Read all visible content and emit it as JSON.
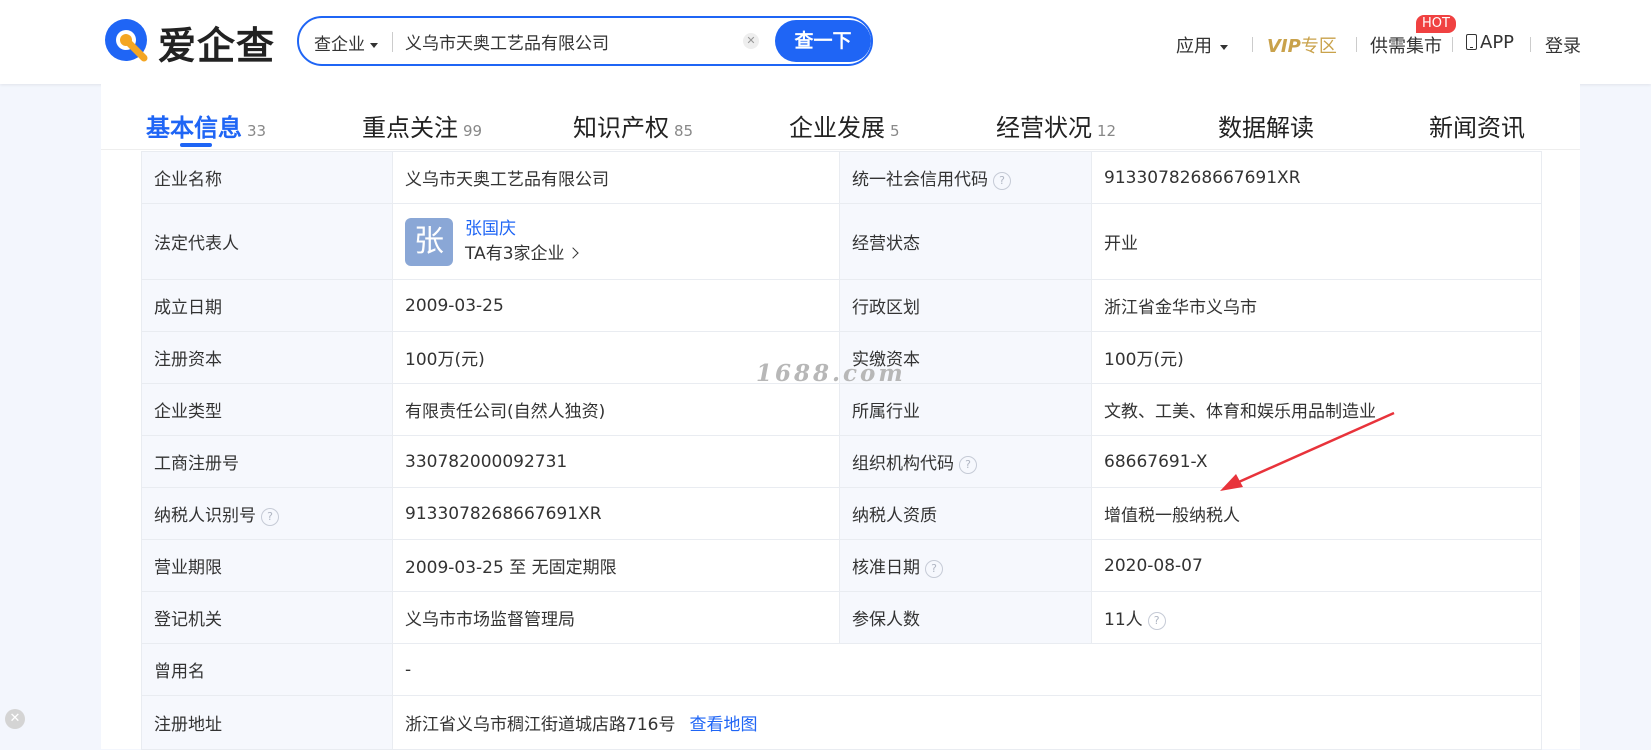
{
  "header": {
    "logo_text": "爱企查",
    "search": {
      "type_label": "查企业",
      "value": "义乌市天奥工艺品有限公司",
      "button_label": "查一下"
    },
    "nav": {
      "apps": "应用",
      "vip_v": "VIP",
      "vip_zone": "专区",
      "supply": "供需集市",
      "hot": "HOT",
      "app": "APP",
      "login": "登录"
    }
  },
  "tabs": [
    {
      "label": "基本信息",
      "count": "33",
      "active": true
    },
    {
      "label": "重点关注",
      "count": "99"
    },
    {
      "label": "知识产权",
      "count": "85"
    },
    {
      "label": "企业发展",
      "count": "5"
    },
    {
      "label": "经营状况",
      "count": "12"
    },
    {
      "label": "数据解读",
      "count": ""
    },
    {
      "label": "新闻资讯",
      "count": ""
    }
  ],
  "info": {
    "company_name_label": "企业名称",
    "company_name": "义乌市天奥工艺品有限公司",
    "credit_code_label": "统一社会信用代码",
    "credit_code": "9133078268667691XR",
    "legal_rep_label": "法定代表人",
    "legal_rep_avatar": "张",
    "legal_rep_name": "张国庆",
    "legal_rep_companies": "TA有3家企业",
    "status_label": "经营状态",
    "status": "开业",
    "founded_label": "成立日期",
    "founded": "2009-03-25",
    "region_label": "行政区划",
    "region": "浙江省金华市义乌市",
    "reg_capital_label": "注册资本",
    "reg_capital": "100万(元)",
    "paid_capital_label": "实缴资本",
    "paid_capital": "100万(元)",
    "type_label": "企业类型",
    "type": "有限责任公司(自然人独资)",
    "industry_label": "所属行业",
    "industry": "文教、工美、体育和娱乐用品制造业",
    "reg_no_label": "工商注册号",
    "reg_no": "330782000092731",
    "org_code_label": "组织机构代码",
    "org_code": "68667691-X",
    "taxpayer_id_label": "纳税人识别号",
    "taxpayer_id": "9133078268667691XR",
    "taxpayer_qual_label": "纳税人资质",
    "taxpayer_qual": "增值税一般纳税人",
    "term_label": "营业期限",
    "term": "2009-03-25 至 无固定期限",
    "approve_label": "核准日期",
    "approve": "2020-08-07",
    "authority_label": "登记机关",
    "authority": "义乌市市场监督管理局",
    "insured_label": "参保人数",
    "insured": "11人",
    "former_name_label": "曾用名",
    "former_name": "-",
    "address_label": "注册地址",
    "address": "浙江省义乌市稠江街道城店路716号",
    "map_link": "查看地图"
  },
  "watermark": "1688.com",
  "colors": {
    "brand": "#1f65f5",
    "vip": "#c9a24b",
    "hot": "#f04141",
    "arrow": "#e8333b"
  }
}
